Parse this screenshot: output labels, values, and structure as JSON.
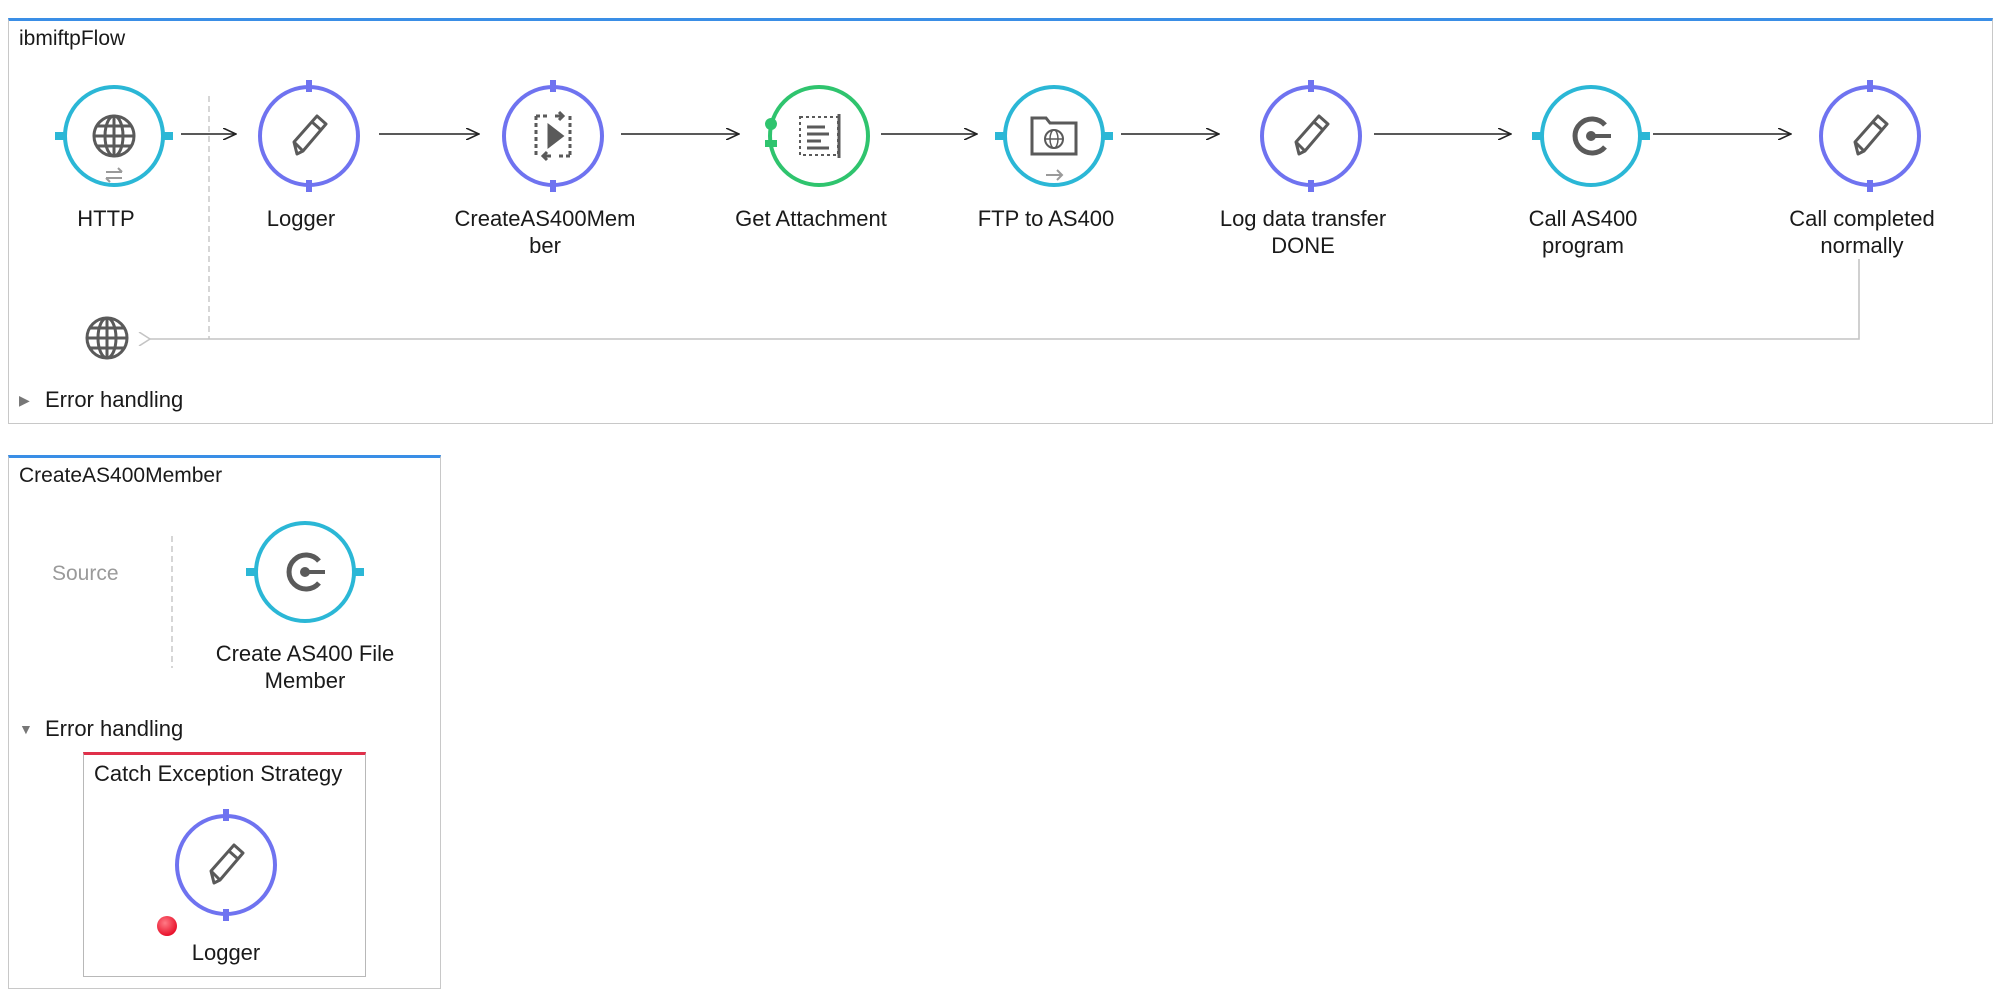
{
  "main_flow": {
    "title": "ibmiftpFlow",
    "nodes": [
      {
        "label": "HTTP",
        "icon": "globe-icon"
      },
      {
        "label": "Logger",
        "icon": "pencil-icon"
      },
      {
        "label": "CreateAS400Mem\nber",
        "icon": "flow-reference-icon"
      },
      {
        "label": "Get Attachment",
        "icon": "attachment-transformer-icon"
      },
      {
        "label": "FTP to AS400",
        "icon": "ftp-folder-icon"
      },
      {
        "label": "Log data transfer\nDONE",
        "icon": "pencil-icon"
      },
      {
        "label": "Call AS400\nprogram",
        "icon": "connector-icon"
      },
      {
        "label": "Call completed\nnormally",
        "icon": "pencil-icon"
      }
    ],
    "response_icon": "globe-icon",
    "error_handling_label": "Error handling",
    "error_handling_expanded": false
  },
  "sub_flow": {
    "title": "CreateAS400Member",
    "source_label": "Source",
    "node": {
      "label": "Create AS400 File\nMember",
      "icon": "connector-icon"
    },
    "error_handling_label": "Error handling",
    "error_handling_expanded": true,
    "strategy": {
      "title": "Catch Exception Strategy",
      "node": {
        "label": "Logger",
        "icon": "pencil-icon"
      }
    }
  },
  "colors": {
    "flow_header": "#3a8ee6",
    "endpoint_ring": "#2bb7d6",
    "processor_ring": "#6f73f0",
    "transformer_ring": "#2fc46e",
    "exception_strategy_bar": "#e0304a",
    "breakpoint_dot": "#e8102a",
    "icon_gray": "#5a5a5a"
  }
}
